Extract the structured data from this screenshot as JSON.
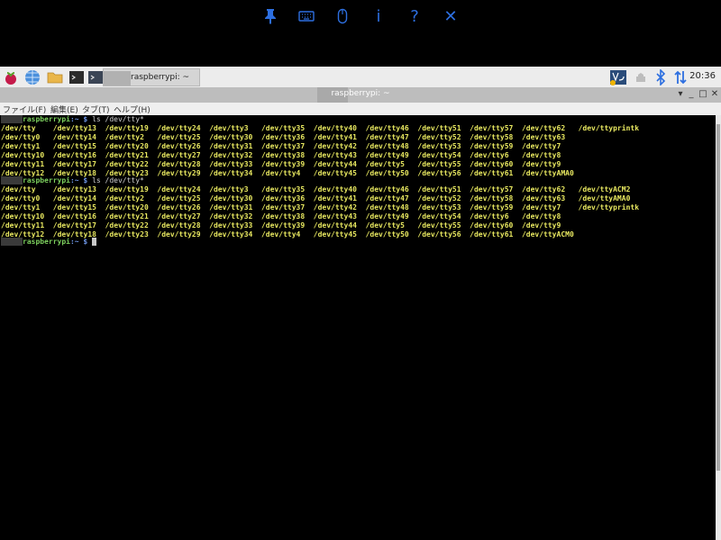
{
  "vnc_toolbar": {
    "icons": [
      "pin-icon",
      "keyboard-icon",
      "mouse-icon",
      "info-icon",
      "help-icon",
      "close-icon"
    ],
    "info_glyph": "i",
    "help_glyph": "?",
    "close_glyph": "✕"
  },
  "taskbar": {
    "window_label": "raspberrypi: ~",
    "clock": "20:36",
    "colors": {
      "bg": "#ececec",
      "accent": "#2d6fe0"
    }
  },
  "window": {
    "title": "raspberrypi: ~",
    "minimize": "_",
    "maximize": "□",
    "close": "✕",
    "dropdown": "▾"
  },
  "menu": [
    "ファイル(F)",
    "編集(E)",
    "タブ(T)",
    "ヘルプ(H)"
  ],
  "terminal": {
    "prompt_host": "raspberrypi",
    "prompt_sep": ":~ $ ",
    "command": "ls /dev/tty*",
    "rows1": [
      "/dev/tty    /dev/tty13  /dev/tty19  /dev/tty24  /dev/tty3   /dev/tty35  /dev/tty40  /dev/tty46  /dev/tty51  /dev/tty57  /dev/tty62   /dev/ttyprintk",
      "/dev/tty0   /dev/tty14  /dev/tty2   /dev/tty25  /dev/tty30  /dev/tty36  /dev/tty41  /dev/tty47  /dev/tty52  /dev/tty58  /dev/tty63",
      "/dev/tty1   /dev/tty15  /dev/tty20  /dev/tty26  /dev/tty31  /dev/tty37  /dev/tty42  /dev/tty48  /dev/tty53  /dev/tty59  /dev/tty7",
      "/dev/tty10  /dev/tty16  /dev/tty21  /dev/tty27  /dev/tty32  /dev/tty38  /dev/tty43  /dev/tty49  /dev/tty54  /dev/tty6   /dev/tty8",
      "/dev/tty11  /dev/tty17  /dev/tty22  /dev/tty28  /dev/tty33  /dev/tty39  /dev/tty44  /dev/tty5   /dev/tty55  /dev/tty60  /dev/tty9",
      "/dev/tty12  /dev/tty18  /dev/tty23  /dev/tty29  /dev/tty34  /dev/tty4   /dev/tty45  /dev/tty50  /dev/tty56  /dev/tty61  /dev/ttyAMA0"
    ],
    "rows2": [
      "/dev/tty    /dev/tty13  /dev/tty19  /dev/tty24  /dev/tty3   /dev/tty35  /dev/tty40  /dev/tty46  /dev/tty51  /dev/tty57  /dev/tty62   /dev/ttyACM2",
      "/dev/tty0   /dev/tty14  /dev/tty2   /dev/tty25  /dev/tty30  /dev/tty36  /dev/tty41  /dev/tty47  /dev/tty52  /dev/tty58  /dev/tty63   /dev/ttyAMA0",
      "/dev/tty1   /dev/tty15  /dev/tty20  /dev/tty26  /dev/tty31  /dev/tty37  /dev/tty42  /dev/tty48  /dev/tty53  /dev/tty59  /dev/tty7    /dev/ttyprintk",
      "/dev/tty10  /dev/tty16  /dev/tty21  /dev/tty27  /dev/tty32  /dev/tty38  /dev/tty43  /dev/tty49  /dev/tty54  /dev/tty6   /dev/tty8",
      "/dev/tty11  /dev/tty17  /dev/tty22  /dev/tty28  /dev/tty33  /dev/tty39  /dev/tty44  /dev/tty5   /dev/tty55  /dev/tty60  /dev/tty9",
      "/dev/tty12  /dev/tty18  /dev/tty23  /dev/tty29  /dev/tty34  /dev/tty4   /dev/tty45  /dev/tty50  /dev/tty56  /dev/tty61  /dev/ttyACM0"
    ],
    "colors": {
      "file": "#e8e860",
      "prompt": "#7ccf5d",
      "path": "#6f97e8"
    }
  }
}
